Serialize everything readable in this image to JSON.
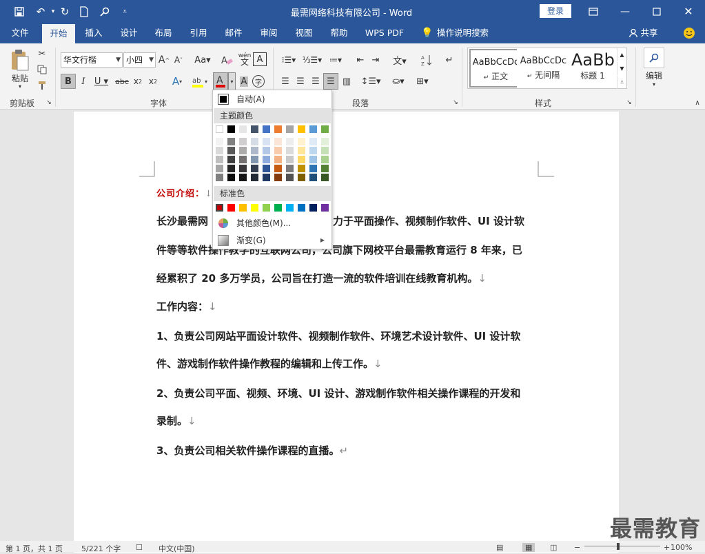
{
  "titlebar": {
    "title": "最需网络科技有限公司 - Word",
    "login": "登录"
  },
  "tabs": [
    "文件",
    "开始",
    "插入",
    "设计",
    "布局",
    "引用",
    "邮件",
    "审阅",
    "视图",
    "帮助",
    "WPS PDF",
    "操作说明搜索"
  ],
  "share": "共享",
  "ribbon": {
    "clipboard": {
      "paste": "粘贴",
      "label": "剪贴板"
    },
    "font": {
      "name": "华文行楷",
      "size": "小四",
      "label": "字体"
    },
    "paragraph": {
      "label": "段落"
    },
    "styles": {
      "items": [
        {
          "preview": "AaBbCcDc",
          "name": "正文"
        },
        {
          "preview": "AaBbCcDc",
          "name": "无间隔"
        },
        {
          "preview": "AaBb",
          "name": "标题 1"
        }
      ],
      "label": "样式"
    },
    "editing": {
      "label": "编辑"
    }
  },
  "color_menu": {
    "auto": "自动(A)",
    "theme_header": "主题颜色",
    "theme_top": [
      "#ffffff",
      "#000000",
      "#e7e6e6",
      "#44546a",
      "#4472c4",
      "#ed7d31",
      "#a5a5a5",
      "#ffc000",
      "#5b9bd5",
      "#70ad47"
    ],
    "theme_shades": [
      [
        "#f2f2f2",
        "#d9d9d9",
        "#bfbfbf",
        "#a6a6a6",
        "#808080"
      ],
      [
        "#808080",
        "#595959",
        "#404040",
        "#262626",
        "#0d0d0d"
      ],
      [
        "#d0cece",
        "#aeabab",
        "#757171",
        "#3a3838",
        "#171616"
      ],
      [
        "#d6dce5",
        "#adb9ca",
        "#8497b0",
        "#333f50",
        "#222a35"
      ],
      [
        "#d9e2f3",
        "#b4c7e7",
        "#8faadc",
        "#2f5597",
        "#1f3864"
      ],
      [
        "#fbe5d6",
        "#f8cbad",
        "#f4b183",
        "#c55a11",
        "#843c0c"
      ],
      [
        "#ededed",
        "#dbdbdb",
        "#c9c9c9",
        "#7b7b7b",
        "#525252"
      ],
      [
        "#fff2cc",
        "#ffe699",
        "#ffd966",
        "#bf9000",
        "#7f6000"
      ],
      [
        "#deebf7",
        "#bdd7ee",
        "#9dc3e6",
        "#2e75b6",
        "#1f4e79"
      ],
      [
        "#e2f0d9",
        "#c5e0b4",
        "#a9d18e",
        "#548235",
        "#385723"
      ]
    ],
    "standard_header": "标准色",
    "standard": [
      "#c00000",
      "#ff0000",
      "#ffc000",
      "#ffff00",
      "#92d050",
      "#00b050",
      "#00b0f0",
      "#0070c0",
      "#002060",
      "#7030a0"
    ],
    "more": "其他颜色(M)...",
    "gradient": "渐变(G)"
  },
  "document": {
    "heading": "公司介绍：",
    "paragraphs": [
      "长沙最需网",
      "力于平面操作、视频制作软件、UI 设计软",
      "件等等软件操作教学的互联网公司，公司旗下网校平台最需教育运行 8 年来，已",
      "经累积了 20 多万学员，公司旨在打造一流的软件培训在线教育机构。",
      "工作内容：",
      "1、负责公司网站平面设计软件、视频制作软件、环境艺术设计软件、UI 设计软",
      "件、游戏制作软件操作教程的编辑和上传工作。",
      "2、负责公司平面、视频、环境、UI 设计、游戏制作软件相关操作课程的开发和",
      "录制。",
      "3、负责公司相关软件操作课程的直播。"
    ]
  },
  "status": {
    "page": "第 1 页，共 1 页",
    "words": "5/221 个字",
    "lang": "中文(中国)",
    "zoom": "100%"
  },
  "watermark": "最需教育"
}
